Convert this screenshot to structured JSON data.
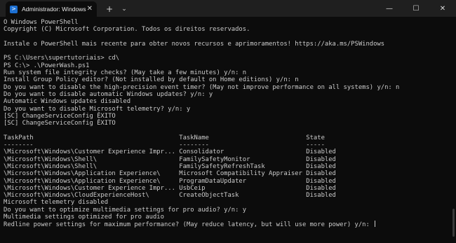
{
  "tab": {
    "title": "Administrador: Windows Pow",
    "icon": "powershell-icon",
    "close": "✕"
  },
  "titlebar": {
    "new_tab": "+",
    "dropdown": "⌄",
    "minimize": "—",
    "maximize": "☐",
    "close": "✕"
  },
  "terminal": {
    "lines": [
      "O Windows PowerShell",
      "Copyright (C) Microsoft Corporation. Todos os direitos reservados.",
      "",
      "Instale o PowerShell mais recente para obter novos recursos e aprimoramentos! https://aka.ms/PSWindows",
      "",
      "PS C:\\Users\\supertutoriais> cd\\",
      "PS C:\\> .\\PowerWash.ps1",
      "Run system file integrity checks? (May take a few minutes) y/n: n",
      "Install Group Policy editor? (Not installed by default on Home editions) y/n: n",
      "Do you want to disable the high-precision event timer? (May not improve performance on all systems) y/n: n",
      "Do you want to disable automatic Windows updates? y/n: y",
      "Automatic Windows updates disabled",
      "Do you want to disable Microsoft telemetry? y/n: y",
      "[SC] ChangeServiceConfig ÊXITO",
      "[SC] ChangeServiceConfig ÊXITO",
      "",
      "TaskPath                                       TaskName                          State",
      "--------                                       --------                          -----",
      "\\Microsoft\\Windows\\Customer Experience Impr... Consolidator                      Disabled",
      "\\Microsoft\\Windows\\Shell\\                      FamilySafetyMonitor               Disabled",
      "\\Microsoft\\Windows\\Shell\\                      FamilySafetyRefreshTask           Disabled",
      "\\Microsoft\\Windows\\Application Experience\\     Microsoft Compatibility Appraiser Disabled",
      "\\Microsoft\\Windows\\Application Experience\\     ProgramDataUpdater                Disabled",
      "\\Microsoft\\Windows\\Customer Experience Impr... UsbCeip                           Disabled",
      "\\Microsoft\\Windows\\CloudExperienceHost\\        CreateObjectTask                  Disabled",
      "Microsoft telemetry disabled",
      "Do you want to optimize multimedia settings for pro audio? y/n: y",
      "Multimedia settings optimized for pro audio",
      "Redline power settings for maximum performance? (May reduce latency, but will use more power) y/n: "
    ],
    "cmd_line_5": "cd\\",
    "cmd_line_6": ".\\PowerWash.ps1"
  }
}
